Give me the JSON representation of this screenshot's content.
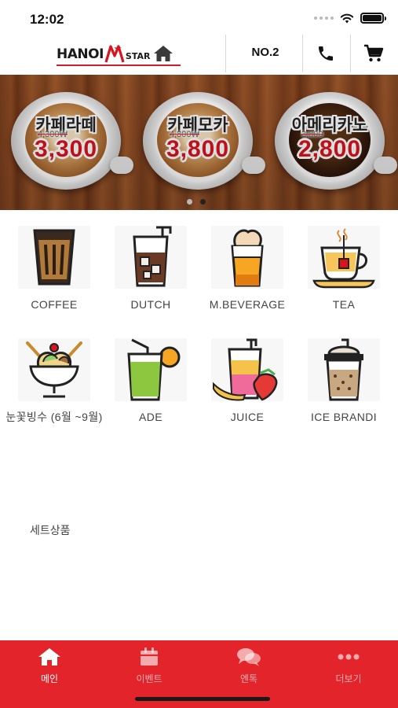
{
  "status_bar": {
    "time": "12:02"
  },
  "header": {
    "logo_text_left": "HANOI",
    "logo_text_right": "STAR",
    "store_name": "NO.2",
    "icons": [
      "home-icon",
      "phone-icon",
      "cart-icon"
    ]
  },
  "banner": {
    "promos": [
      {
        "name": "카페라떼",
        "old_price": "4,300₩",
        "price": "3,300"
      },
      {
        "name": "카페모카",
        "old_price": "4,800₩",
        "price": "3,800"
      },
      {
        "name": "아메리카노",
        "old_price": "3,800",
        "price": "2,800"
      }
    ],
    "pages": 2,
    "active_page": 2
  },
  "categories": [
    {
      "label": "COFFEE",
      "icon": "coffee-glass-icon"
    },
    {
      "label": "DUTCH",
      "icon": "iced-drink-icon"
    },
    {
      "label": "M.BEVERAGE",
      "icon": "whipped-drink-icon"
    },
    {
      "label": "TEA",
      "icon": "tea-cup-icon"
    },
    {
      "label": "눈꽃빙수 (6월 ~9월)",
      "icon": "sundae-icon"
    },
    {
      "label": "ADE",
      "icon": "ade-glass-icon"
    },
    {
      "label": "JUICE",
      "icon": "juice-icon"
    },
    {
      "label": "ICE BRANDI",
      "icon": "frappe-icon"
    }
  ],
  "section": {
    "set_products": "세트상품"
  },
  "tabbar": {
    "tabs": [
      {
        "label": "메인",
        "icon": "home-icon",
        "active": true
      },
      {
        "label": "이벤트",
        "icon": "calendar-icon",
        "active": false
      },
      {
        "label": "엔톡",
        "icon": "chat-icon",
        "active": false
      },
      {
        "label": "더보기",
        "icon": "more-icon",
        "active": false
      }
    ]
  },
  "colors": {
    "brand_red": "#e3242b",
    "price_red": "#d8141f"
  }
}
